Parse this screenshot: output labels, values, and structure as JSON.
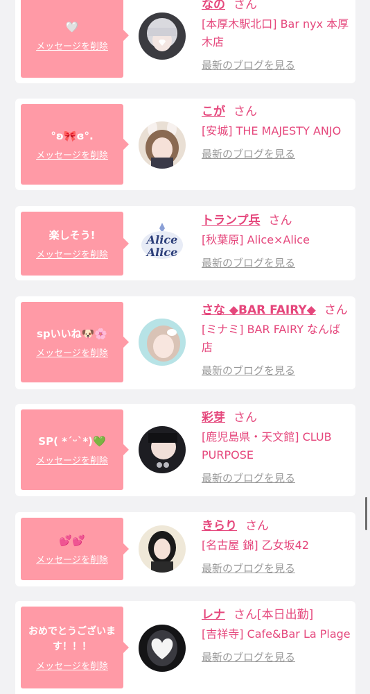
{
  "entries": [
    {
      "message": "🤍",
      "delete_label": "メッセージを削除",
      "avatar": "cast-avatar-silver-hair",
      "name": "なの",
      "honorific": "さん",
      "status": "",
      "shop": "[本厚木駅北口] Bar nyx 本厚木店",
      "blog_link": "最新のブログを見る"
    },
    {
      "message": "°ʚ🎀ɞ°.",
      "delete_label": "メッセージを削除",
      "avatar": "cast-avatar-bunny-ears",
      "name": "こが",
      "honorific": "さん",
      "status": "",
      "shop": "[安城] THE MAJESTY ANJO",
      "blog_link": "最新のブログを見る"
    },
    {
      "message": "楽しそう!",
      "delete_label": "メッセージを削除",
      "avatar": "alice-logo",
      "name": "トランプ兵",
      "honorific": "さん",
      "status": "",
      "shop": "[秋葉原] Alice×Alice",
      "blog_link": "最新のブログを見る"
    },
    {
      "message": "spいいね🐶🌸",
      "delete_label": "メッセージを削除",
      "avatar": "cast-avatar-peace-sign",
      "name": "さな ◆BAR FAIRY◆",
      "honorific": "さん",
      "status": "",
      "shop": "[ミナミ] BAR FAIRY なんば店",
      "blog_link": "最新のブログを見る"
    },
    {
      "message": "SP( *´ᵕ`*)💚",
      "delete_label": "メッセージを削除",
      "avatar": "cast-avatar-dark-hair",
      "name": "彩芽",
      "honorific": "さん",
      "status": "",
      "shop": "[鹿児島県・天文館] CLUB PURPOSE",
      "blog_link": "最新のブログを見る"
    },
    {
      "message": "💕💕",
      "delete_label": "メッセージを削除",
      "avatar": "cast-avatar-black-hair",
      "name": "きらり",
      "honorific": "さん",
      "status": "",
      "shop": "[名古屋 錦] 乙女坂42",
      "blog_link": "最新のブログを見る"
    },
    {
      "message": "おめでとうございます！！！",
      "delete_label": "メッセージを削除",
      "avatar": "cast-avatar-heart-cover",
      "name": "レナ",
      "honorific": "さん",
      "status": "[本日出勤]",
      "shop": "[吉祥寺] Cafe&Bar La Plage",
      "blog_link": "最新のブログを見る"
    }
  ],
  "colors": {
    "accent": "#e5477c",
    "bubble": "#ff9aa6",
    "muted": "#999999",
    "background": "#f2f2f4"
  }
}
